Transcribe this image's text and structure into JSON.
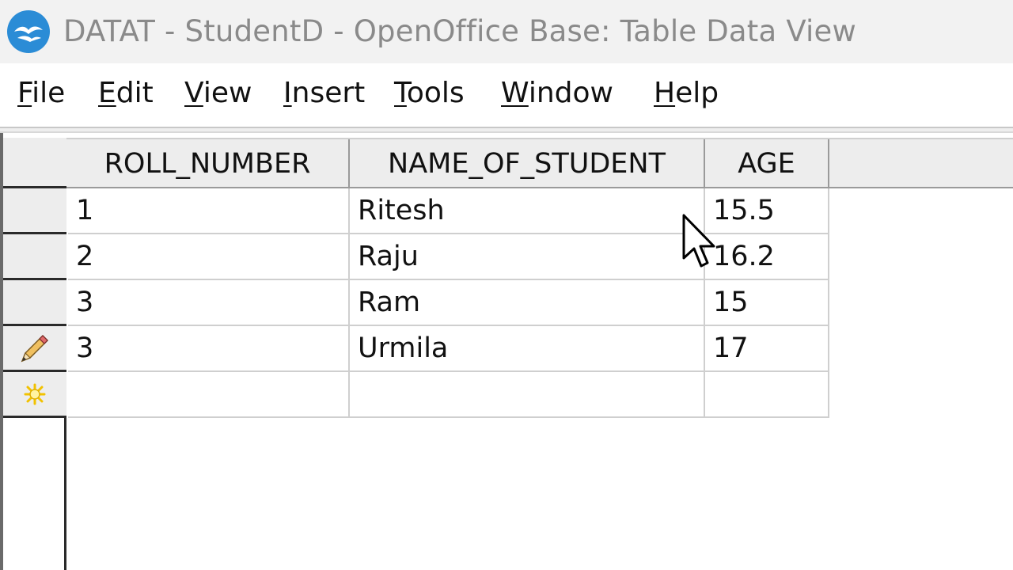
{
  "window": {
    "title": "DATAT - StudentD - OpenOffice Base: Table Data View"
  },
  "menu": [
    {
      "label": "File",
      "mnemonic": "F",
      "rest": "ile"
    },
    {
      "label": "Edit",
      "mnemonic": "E",
      "rest": "dit"
    },
    {
      "label": "View",
      "mnemonic": "V",
      "rest": "iew"
    },
    {
      "label": "Insert",
      "mnemonic": "I",
      "rest": "nsert"
    },
    {
      "label": "Tools",
      "mnemonic": "T",
      "rest": "ools"
    },
    {
      "label": "Window",
      "mnemonic": "W",
      "rest": "indow"
    },
    {
      "label": "Help",
      "mnemonic": "H",
      "rest": "elp"
    }
  ],
  "table": {
    "columns": [
      "ROLL_NUMBER",
      "NAME_OF_STUDENT",
      "AGE"
    ],
    "rows": [
      {
        "marker": "none",
        "cells": [
          "1",
          "Ritesh",
          "15.5"
        ]
      },
      {
        "marker": "none",
        "cells": [
          "2",
          "Raju",
          "16.2"
        ]
      },
      {
        "marker": "none",
        "cells": [
          "3",
          "Ram",
          "15"
        ]
      },
      {
        "marker": "edit-pencil-icon",
        "cells": [
          "3",
          "Urmila",
          "17"
        ]
      },
      {
        "marker": "new-row-star-icon",
        "cells": [
          "",
          "",
          ""
        ]
      }
    ]
  },
  "icons": {
    "app": "openoffice-gull-icon",
    "edit_row": "pencil-icon",
    "new_row": "new-record-star-icon",
    "pointer": "mouse-pointer-icon"
  },
  "colors": {
    "app_icon_blue": "#2b8cd6",
    "title_text": "#8a8a8a",
    "header_bg": "#ededed",
    "new_row_star": "#f2c200"
  }
}
